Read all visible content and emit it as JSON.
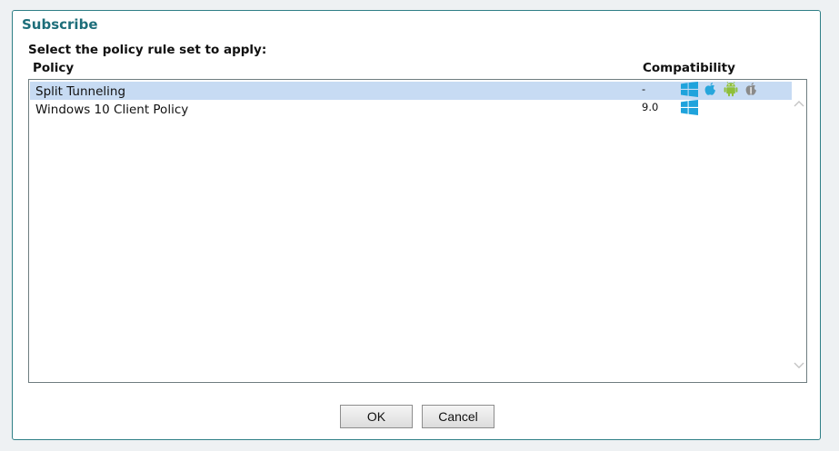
{
  "dialog": {
    "title": "Subscribe",
    "prompt": "Select the policy rule set to apply:",
    "columns": {
      "policy": "Policy",
      "compatibility": "Compatibility"
    },
    "policies": [
      {
        "name": "Split Tunneling",
        "version": "-",
        "selected": true,
        "icons": [
          "windows-icon",
          "apple-icon",
          "android-icon",
          "macos-icon"
        ]
      },
      {
        "name": "Windows 10 Client Policy",
        "version": "9.0",
        "selected": false,
        "icons": [
          "windows-icon"
        ]
      }
    ],
    "buttons": {
      "ok": "OK",
      "cancel": "Cancel"
    }
  },
  "colors": {
    "accent": "#1d6e7a",
    "selection": "#c7dbf3",
    "windows": "#1fa3dc",
    "apple": "#27a6dc",
    "android": "#8fbf3a",
    "macos": "#8a8a8a"
  }
}
